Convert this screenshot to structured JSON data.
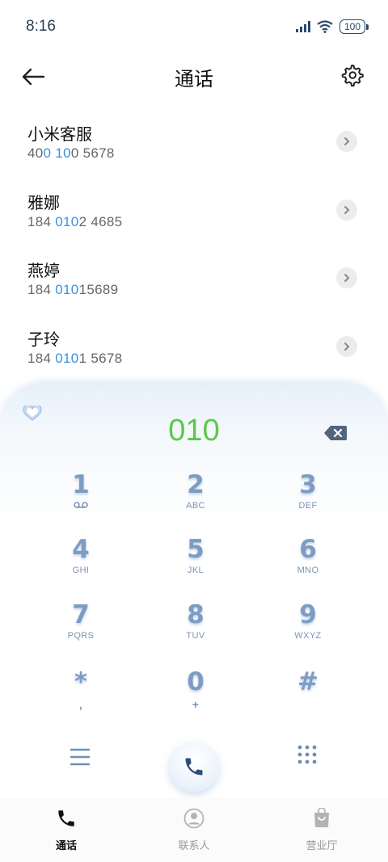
{
  "status_bar": {
    "time": "8:16",
    "battery": "100"
  },
  "header": {
    "title": "通话"
  },
  "contacts": [
    {
      "name": "小米客服",
      "number_parts": [
        "40",
        "0",
        " ",
        "10",
        "0 5678"
      ],
      "highlight": [
        false,
        true,
        false,
        true,
        false
      ]
    },
    {
      "name": "雅娜",
      "number_parts": [
        "184 ",
        "010",
        "2 4685"
      ],
      "highlight": [
        false,
        true,
        false
      ]
    },
    {
      "name": "燕婷",
      "number_parts": [
        "184 ",
        "010",
        "15689"
      ],
      "highlight": [
        false,
        true,
        false
      ]
    },
    {
      "name": "子玲",
      "number_parts": [
        "184 ",
        "010",
        "1 5678"
      ],
      "highlight": [
        false,
        true,
        false
      ]
    }
  ],
  "dialer": {
    "input": "010",
    "keys": [
      {
        "digit": "1",
        "letters": "voicemail"
      },
      {
        "digit": "2",
        "letters": "ABC"
      },
      {
        "digit": "3",
        "letters": "DEF"
      },
      {
        "digit": "4",
        "letters": "GHI"
      },
      {
        "digit": "5",
        "letters": "JKL"
      },
      {
        "digit": "6",
        "letters": "MNO"
      },
      {
        "digit": "7",
        "letters": "PQRS"
      },
      {
        "digit": "8",
        "letters": "TUV"
      },
      {
        "digit": "9",
        "letters": "WXYZ"
      },
      {
        "digit": "*",
        "letters": ","
      },
      {
        "digit": "0",
        "letters": "+"
      },
      {
        "digit": "#",
        "letters": ""
      }
    ]
  },
  "bottom_nav": {
    "items": [
      {
        "label": "通话",
        "icon": "phone-icon",
        "active": true
      },
      {
        "label": "联系人",
        "icon": "contact-icon",
        "active": false
      },
      {
        "label": "营业厅",
        "icon": "bag-icon",
        "active": false
      }
    ]
  },
  "colors": {
    "accent_green": "#5cc84a",
    "highlight_blue": "#3b8fe6",
    "key_blue": "#7d9cc4"
  }
}
